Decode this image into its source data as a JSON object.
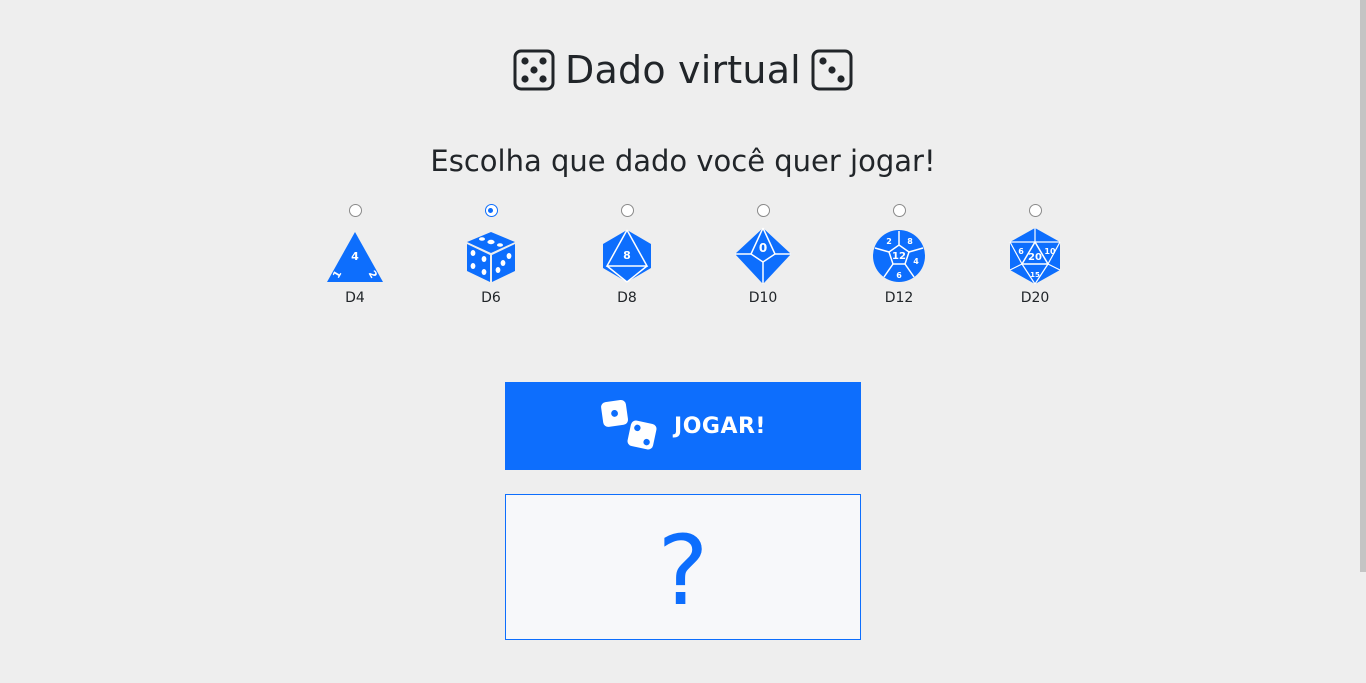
{
  "header": {
    "title": "Dado virtual",
    "left_icon": "die-face-five-icon",
    "right_icon": "die-face-three-icon"
  },
  "subtitle": "Escolha que dado você quer jogar!",
  "dice": [
    {
      "label": "D4",
      "icon": "d4-icon",
      "selected": false
    },
    {
      "label": "D6",
      "icon": "d6-icon",
      "selected": true
    },
    {
      "label": "D8",
      "icon": "d8-icon",
      "selected": false
    },
    {
      "label": "D10",
      "icon": "d10-icon",
      "selected": false
    },
    {
      "label": "D12",
      "icon": "d12-icon",
      "selected": false
    },
    {
      "label": "D20",
      "icon": "d20-icon",
      "selected": false
    }
  ],
  "die_face_numbers": {
    "d4": [
      "4",
      "1",
      "2"
    ],
    "d8": [
      "8"
    ],
    "d10": [
      "0"
    ],
    "d12": [
      "12",
      "2",
      "8",
      "6",
      "4"
    ],
    "d20": [
      "20",
      "6",
      "10",
      "15"
    ]
  },
  "play_button": {
    "label": "JOGAR!",
    "icon": "dice-pair-icon"
  },
  "result": {
    "value": "?"
  },
  "colors": {
    "accent": "#0d6efd",
    "background": "#eeeeee",
    "result_background": "#f7f8fa"
  }
}
